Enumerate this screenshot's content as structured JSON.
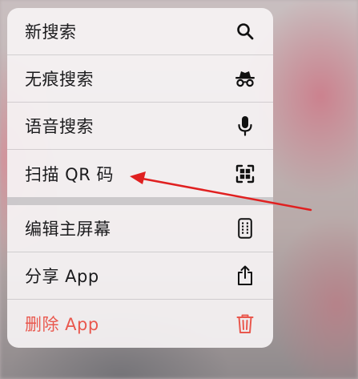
{
  "menu": {
    "items": [
      {
        "label": "新搜索",
        "icon": "search-icon"
      },
      {
        "label": "无痕搜索",
        "icon": "incognito-icon"
      },
      {
        "label": "语音搜索",
        "icon": "microphone-icon"
      },
      {
        "label": "扫描 QR 码",
        "icon": "qr-scan-icon"
      },
      {
        "label": "编辑主屏幕",
        "icon": "phone-grid-icon"
      },
      {
        "label": "分享 App",
        "icon": "share-icon"
      },
      {
        "label": "删除 App",
        "icon": "trash-icon"
      }
    ]
  },
  "colors": {
    "danger": "#e9574d",
    "annotation": "#e02020"
  }
}
